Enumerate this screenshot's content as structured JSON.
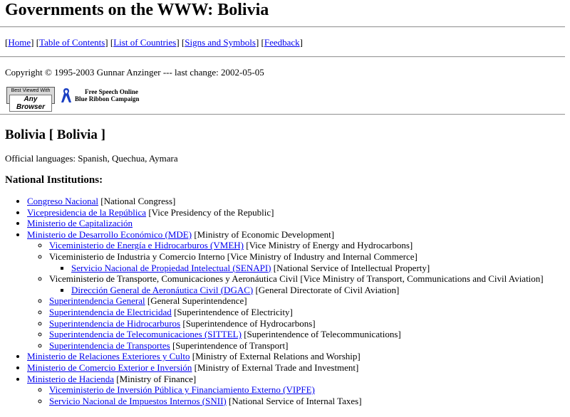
{
  "title": "Governments on the WWW: Bolivia",
  "nav": {
    "home": "Home",
    "toc": "Table of Contents",
    "countries": "List of Countries",
    "symbols": "Signs and Symbols",
    "feedback": "Feedback"
  },
  "copyright": "Copyright © 1995-2003 Gunnar Anzinger --- last change: 2002-05-05",
  "badges": {
    "browser_line1": "Best Viewed With",
    "browser_line2": "Any Browser",
    "campaign_line1": "Free Speech Online",
    "campaign_line2": "Blue Ribbon Campaign"
  },
  "country_heading": "Bolivia [ Bolivia ]",
  "languages": "Official languages: Spanish, Quechua, Aymara",
  "section_heading": "National Institutions:",
  "institutions": [
    {
      "link": "Congreso Nacional",
      "note": " [National Congress]"
    },
    {
      "link": "Vicepresidencia de la República",
      "note": " [Vice Presidency of the Republic]"
    },
    {
      "link": "Ministerio de Capitalización",
      "note": ""
    },
    {
      "link": "Ministerio de Desarrollo Económico (MDE)",
      "note": " [Ministry of Economic Development]",
      "children": [
        {
          "link": "Viceministerio de Energía e Hidrocarburos (VMEH)",
          "note": " [Vice Ministry of Energy and Hydrocarbons]"
        },
        {
          "text": "Viceministerio de Industria y Comercio Interno",
          "note": " [Vice Ministry of Industry and Internal Commerce]",
          "children": [
            {
              "link": "Servicio Nacional de Propiedad Intelectual (SENAPI)",
              "note": " [National Service of Intellectual Property]"
            }
          ]
        },
        {
          "text": "Viceministerio de Transporte, Comunicaciones y Aeronáutica Civil",
          "note": " [Vice Ministry of Transport, Communications and Civil Aviation]",
          "children": [
            {
              "link": "Dirección General de Aeronáutica Civil (DGAC)",
              "note": " [General Directorate of Civil Aviation]"
            }
          ]
        },
        {
          "link": "Superintendencia General",
          "note": " [General Superintendence]"
        },
        {
          "link": "Superintendencia de Electricidad",
          "note": " [Superintendence of Electricity]"
        },
        {
          "link": "Superintendencia de Hidrocarburos",
          "note": " [Superintendence of Hydrocarbons]"
        },
        {
          "link": "Superintendencia de Telecomunicaciones (SITTEL)",
          "note": " [Superintendence of Telecommunications]"
        },
        {
          "link": "Superintendencia de Transportes",
          "note": " [Superintendence of Transport]"
        }
      ]
    },
    {
      "link": "Ministerio de Relaciones Exteriores y Culto",
      "note": " [Ministry of External Relations and Worship]"
    },
    {
      "link": "Ministerio de Comercio Exterior e Inversión",
      "note": " [Ministry of External Trade and Investment]"
    },
    {
      "link": "Ministerio de Hacienda",
      "note": " [Ministry of Finance]",
      "children": [
        {
          "link": "Viceministerio de Inversión Pública y Financiamiento Externo (VIPFE)",
          "note": ""
        },
        {
          "link": "Servicio Nacional de Impuestos Internos (SNII)",
          "note": " [National Service of Internal Taxes]"
        }
      ]
    }
  ]
}
